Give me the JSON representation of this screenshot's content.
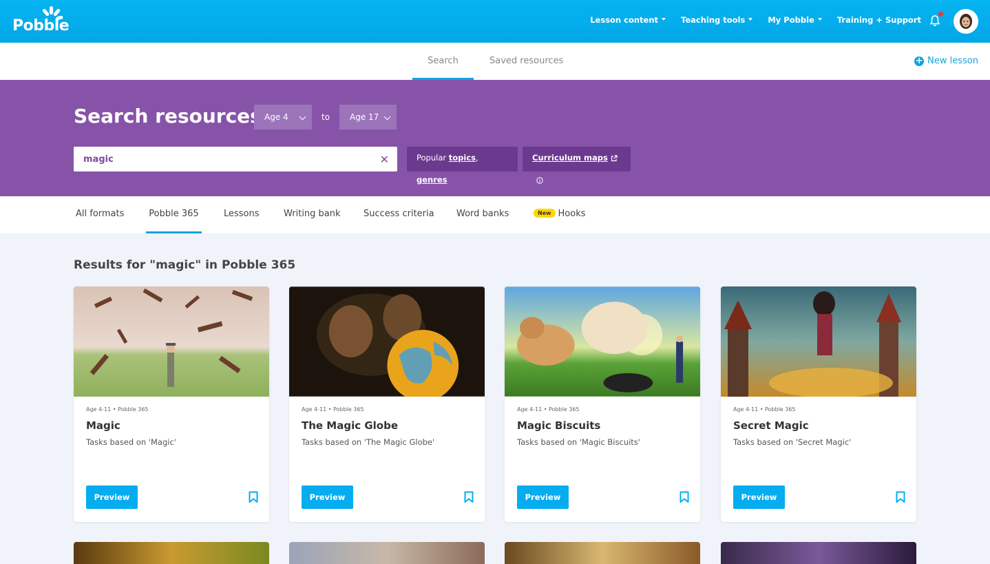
{
  "brand": {
    "name": "Pobble"
  },
  "nav": {
    "items": [
      {
        "label": "Lesson content",
        "dropdown": true
      },
      {
        "label": "Teaching tools",
        "dropdown": true
      },
      {
        "label": "My Pobble",
        "dropdown": true
      },
      {
        "label": "Training + Support",
        "dropdown": false
      }
    ],
    "notification_dot": true
  },
  "subnav": {
    "tabs": [
      {
        "label": "Search",
        "active": true
      },
      {
        "label": "Saved resources",
        "active": false
      }
    ],
    "new_lesson": "New lesson"
  },
  "hero": {
    "title": "Search resources",
    "age_from": "Age 4",
    "to_label": "to",
    "age_to": "Age 17",
    "search_value": "magic",
    "popular_prefix": "Popular",
    "popular_topics": "topics",
    "popular_sep": ",",
    "popular_genres": "genres",
    "curriculum_maps": "Curriculum maps"
  },
  "formats": {
    "tabs": [
      {
        "label": "All formats"
      },
      {
        "label": "Pobble 365",
        "active": true
      },
      {
        "label": "Lessons"
      },
      {
        "label": "Writing bank"
      },
      {
        "label": "Success criteria"
      },
      {
        "label": "Word banks"
      },
      {
        "label": "Hooks",
        "badge": "New"
      }
    ]
  },
  "results": {
    "title": "Results for \"magic\" in Pobble 365",
    "preview_label": "Preview",
    "cards": [
      {
        "meta": "Age 4-11 • Pobble 365",
        "title": "Magic",
        "desc": "Tasks based on 'Magic'"
      },
      {
        "meta": "Age 4-11 • Pobble 365",
        "title": "The Magic Globe",
        "desc": "Tasks based on 'The Magic Globe'"
      },
      {
        "meta": "Age 4-11 • Pobble 365",
        "title": "Magic Biscuits",
        "desc": "Tasks based on 'Magic Biscuits'"
      },
      {
        "meta": "Age 4-11 • Pobble 365",
        "title": "Secret Magic",
        "desc": "Tasks based on 'Secret Magic'"
      }
    ]
  },
  "colors": {
    "primary_blue": "#05adf0",
    "purple": "#8753a9",
    "purple_dark": "#6b3a8e",
    "badge_yellow": "#ffd600"
  }
}
